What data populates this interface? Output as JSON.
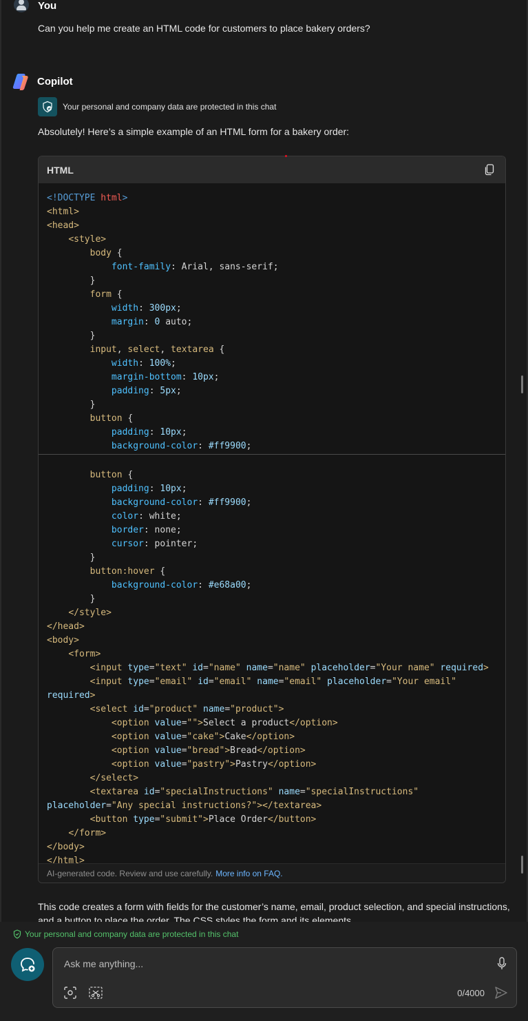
{
  "user": {
    "name": "You",
    "message": "Can you help me create an HTML code for customers to place bakery orders?"
  },
  "assistant": {
    "name": "Copilot",
    "protection_notice": "Your personal and company data are protected in this chat",
    "intro": "Absolutely! Here’s a simple example of an HTML form for a bakery order:",
    "code_block": {
      "language": "HTML",
      "footer_text": "AI-generated code. Review and use carefully.",
      "footer_link": "More info on FAQ."
    },
    "after_code_text": "This code creates a form with fields for the customer’s name, email, product selection, and special instructions, and a button to place the order. The CSS styles the form and its elements."
  },
  "composer": {
    "protection_notice": "Your personal and company data are protected in this chat",
    "placeholder": "Ask me anything...",
    "char_count": "0/4000"
  },
  "colors": {
    "accent_teal": "#0f5f73",
    "protect_green": "#54c26b",
    "link_blue": "#6cb6ff"
  },
  "icons": [
    "user-avatar-icon",
    "copilot-logo-icon",
    "shield-check-icon",
    "copy-icon",
    "new-chat-icon",
    "microphone-icon",
    "camera-scan-icon",
    "screenshot-icon",
    "send-icon"
  ]
}
